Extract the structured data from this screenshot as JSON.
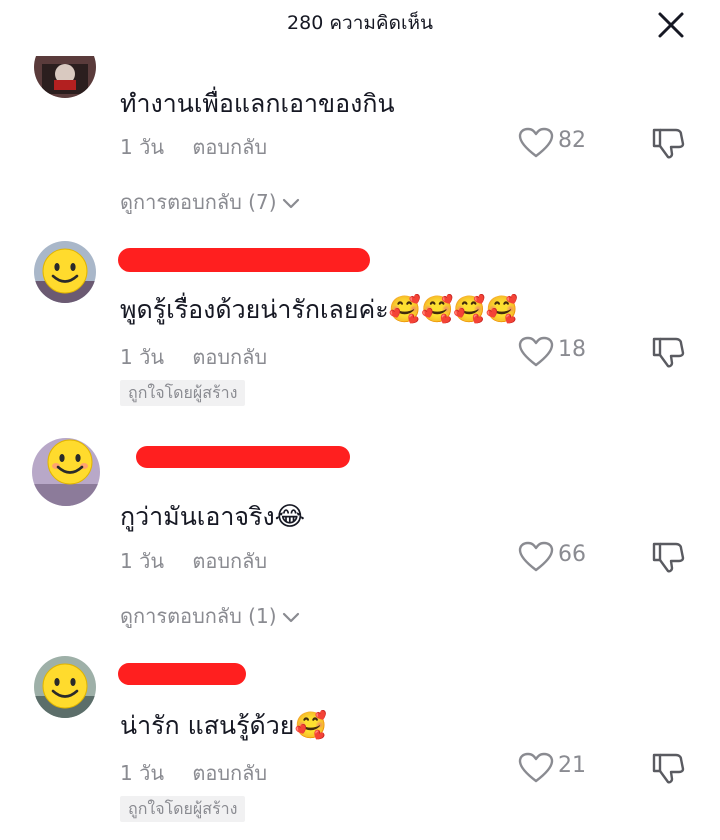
{
  "header": {
    "title": "280 ความคิดเห็น",
    "close_icon": "close-icon"
  },
  "comments": [
    {
      "text": "ทำงานเพื่อแลกเอาของกิน",
      "time": "1 วัน",
      "reply_label": "ตอบกลับ",
      "likes": "82",
      "view_replies": "ดูการตอบกลับ (7)"
    },
    {
      "username": "",
      "text": "พูดรู้เรื่องด้วยน่ารักเลยค่ะ",
      "emojis": "🥰🥰🥰🥰",
      "time": "1 วัน",
      "reply_label": "ตอบกลับ",
      "likes": "18",
      "badge": "ถูกใจโดยผู้สร้าง"
    },
    {
      "username": "",
      "text": "กูว่ามันเอาจริง",
      "emojis": "😂",
      "time": "1 วัน",
      "reply_label": "ตอบกลับ",
      "likes": "66",
      "view_replies": "ดูการตอบกลับ (1)"
    },
    {
      "username": "",
      "text": "น่ารัก แสนรู้ด้วย",
      "emojis": "🥰",
      "time": "1 วัน",
      "reply_label": "ตอบกลับ",
      "likes": "21",
      "badge": "ถูกใจโดยผู้สร้าง"
    }
  ],
  "colors": {
    "text_primary": "#161823",
    "text_secondary": "#8a8b91",
    "redaction": "#ff1f1f",
    "badge_bg": "#f1f1f2",
    "smiley_yellow": "#ffdb2d"
  }
}
